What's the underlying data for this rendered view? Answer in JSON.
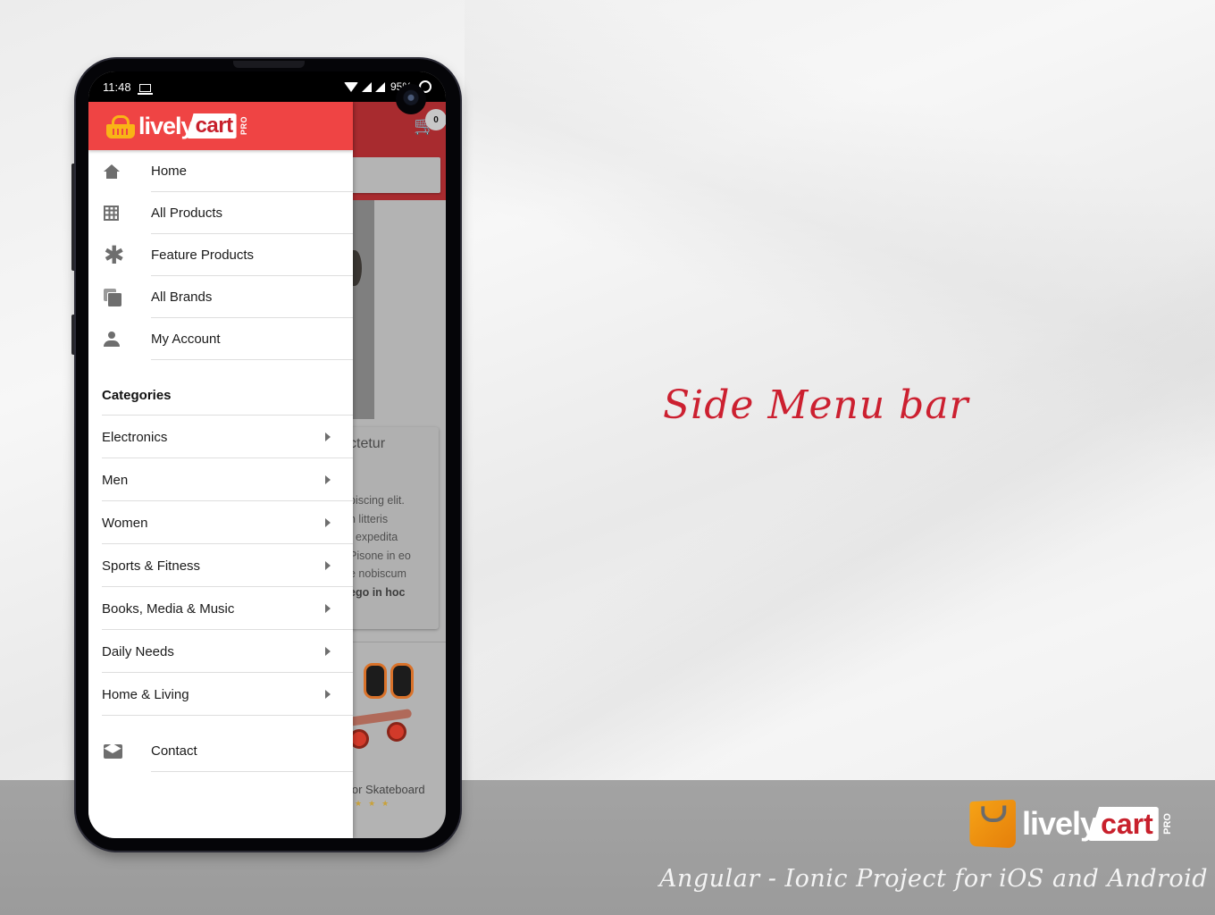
{
  "status_bar": {
    "time": "11:48",
    "battery": "95%",
    "icons": [
      "laptop-icon",
      "wifi-icon",
      "signal-icon",
      "signal-icon",
      "battery-ring-icon"
    ]
  },
  "app_background": {
    "cart_count": "0",
    "card_title_fragment": "ctetur",
    "card_text_lines": [
      "piscing elit.",
      "n litteris",
      "t expedita",
      "Pisone in eo",
      "e nobiscum"
    ],
    "card_text_bold": "ego in hoc",
    "product_name_fragment": "ior Skateboard",
    "rating_stars": "★★★"
  },
  "drawer": {
    "logo": {
      "lively": "lively",
      "cart": "cart",
      "pro": "PRO"
    },
    "menu_items": [
      {
        "label": "Home",
        "icon": "home-icon"
      },
      {
        "label": "All Products",
        "icon": "grid-icon"
      },
      {
        "label": "Feature Products",
        "icon": "asterisk-icon"
      },
      {
        "label": "All Brands",
        "icon": "brands-icon"
      },
      {
        "label": "My Account",
        "icon": "person-icon"
      }
    ],
    "categories_heading": "Categories",
    "categories": [
      {
        "label": "Electronics"
      },
      {
        "label": "Men"
      },
      {
        "label": "Women"
      },
      {
        "label": "Sports & Fitness"
      },
      {
        "label": "Books, Media & Music"
      },
      {
        "label": "Daily Needs"
      },
      {
        "label": "Home & Living"
      }
    ],
    "contact": {
      "label": "Contact",
      "icon": "mail-open-icon"
    }
  },
  "captions": {
    "title": "Side Menu bar",
    "tagline": "Angular - Ionic Project for iOS and Android",
    "footer_logo": {
      "lively": "lively",
      "cart": "cart",
      "pro": "PRO"
    }
  },
  "colors": {
    "drawer_header": "#ef4444",
    "caption_red": "#cc2030",
    "logo_accent": "#f9b416"
  }
}
